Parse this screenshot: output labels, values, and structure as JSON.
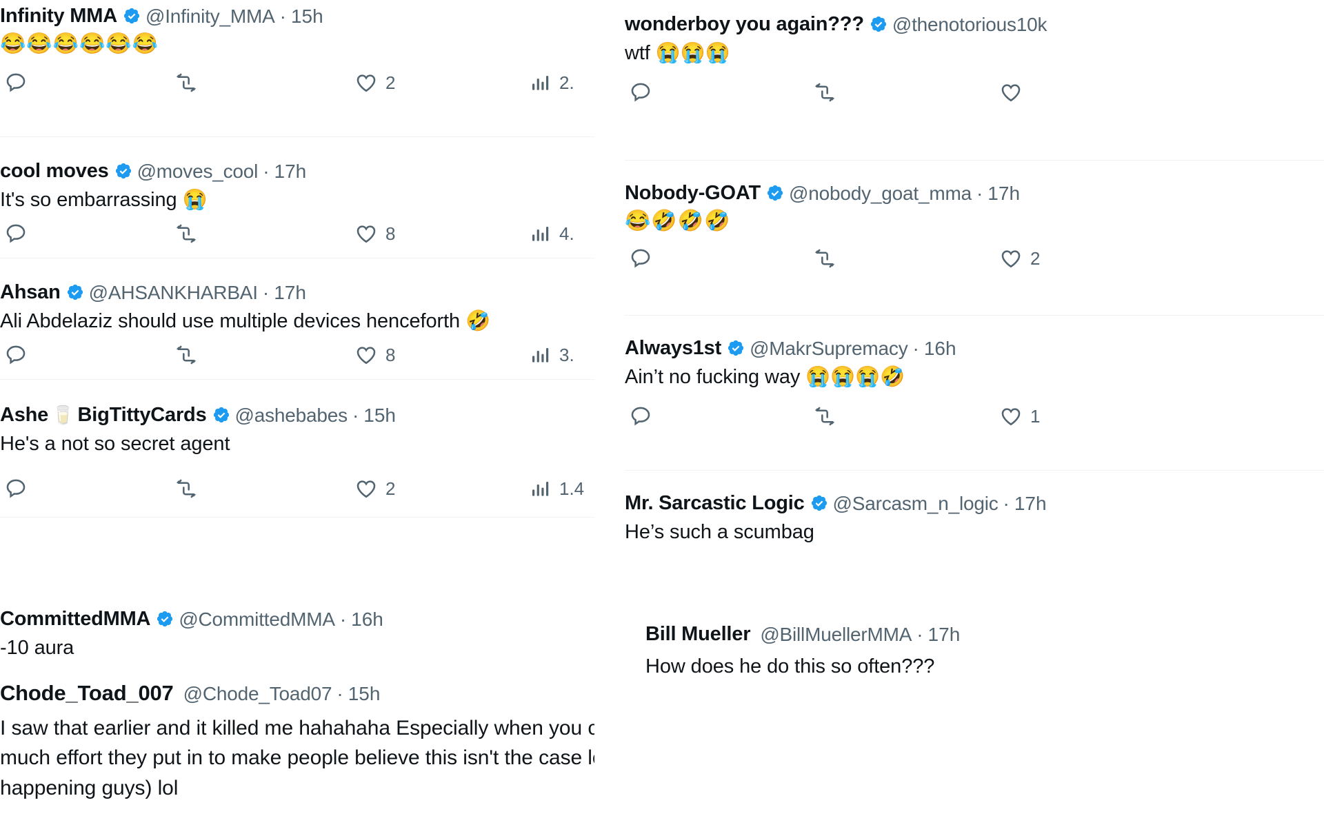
{
  "meta": {
    "platform": "twitter-replies-screenshot",
    "background_color": "#ffffff",
    "text_color": "#0f1419",
    "muted_text_color": "#536471",
    "verified_badge_color": "#1D9BF0",
    "divider_color": "#eff3f4"
  },
  "icons": {
    "reply": "reply-icon",
    "retweet": "retweet-icon",
    "like": "heart-icon",
    "views": "views-bar-chart-icon",
    "verified": "verified-badge-icon"
  },
  "left_column": {
    "tweets": [
      {
        "display_name": "Infinity MMA",
        "verified": true,
        "handle": "@Infinity_MMA",
        "separator": "·",
        "timestamp": "15h",
        "body": "😂😂😂😂😂😂",
        "body_is_emoji": true,
        "actions": {
          "reply_count": "",
          "retweet_count": "",
          "like_count": "2",
          "views_count": "2."
        }
      },
      {
        "display_name": "cool moves",
        "verified": true,
        "handle": "@moves_cool",
        "separator": "·",
        "timestamp": "17h",
        "body": "It's so embarrassing 😭",
        "body_is_emoji": false,
        "actions": {
          "reply_count": "",
          "retweet_count": "",
          "like_count": "8",
          "views_count": "4."
        }
      },
      {
        "display_name": "Ahsan",
        "verified": true,
        "handle": "@AHSANKHARBAI",
        "separator": "·",
        "timestamp": "17h",
        "body": "Ali Abdelaziz should use multiple devices henceforth 🤣",
        "body_is_emoji": false,
        "actions": {
          "reply_count": "",
          "retweet_count": "",
          "like_count": "8",
          "views_count": "3."
        }
      },
      {
        "display_name": "Ashe",
        "name_emoji": "🥛",
        "display_name_2": "BigTittyCards",
        "verified": true,
        "handle": "@ashebabes",
        "separator": "·",
        "timestamp": "15h",
        "body": "He's a not so secret agent",
        "body_is_emoji": false,
        "actions": {
          "reply_count": "",
          "retweet_count": "",
          "like_count": "2",
          "views_count": "1.4"
        }
      },
      {
        "display_name": "CommittedMMA",
        "verified": true,
        "handle": "@CommittedMMA",
        "separator": "·",
        "timestamp": "16h",
        "body": "-10 aura",
        "body_is_emoji": false,
        "actions": null
      },
      {
        "display_name": "Chode_Toad_007",
        "verified": false,
        "handle": "@Chode_Toad07",
        "separator": "·",
        "timestamp": "15h",
        "body": "I saw that earlier and it killed me hahahaha Especially when you consider how much effort they put in to make people believe this isn't the case lol (it's not happening guys) lol",
        "body_is_emoji": false,
        "actions": null
      }
    ]
  },
  "right_column": {
    "tweets": [
      {
        "display_name": "wonderboy you again???",
        "verified": true,
        "handle": "@thenotorious10k",
        "separator": "",
        "timestamp": "",
        "body": "wtf 😭😭😭",
        "body_is_emoji": false,
        "actions": {
          "reply_count": "",
          "retweet_count": "",
          "like_count": ""
        }
      },
      {
        "display_name": "Nobody-GOAT",
        "verified": true,
        "handle": "@nobody_goat_mma",
        "separator": "·",
        "timestamp": "17h",
        "body": "😂🤣🤣🤣",
        "body_is_emoji": true,
        "actions": {
          "reply_count": "",
          "retweet_count": "",
          "like_count": "2"
        }
      },
      {
        "display_name": "Always1st",
        "verified": true,
        "handle": "@MakrSupremacy",
        "separator": "·",
        "timestamp": "16h",
        "body": "Ain’t no fucking way 😭😭😭🤣",
        "body_is_emoji": false,
        "actions": {
          "reply_count": "",
          "retweet_count": "",
          "like_count": "1"
        }
      },
      {
        "display_name": "Mr. Sarcastic Logic",
        "verified": true,
        "handle": "@Sarcasm_n_logic",
        "separator": "·",
        "timestamp": "17h",
        "body": "He’s such a scumbag",
        "body_is_emoji": false,
        "actions": null
      },
      {
        "display_name": "Bill Mueller",
        "verified": false,
        "handle": "@BillMuellerMMA",
        "separator": "·",
        "timestamp": "17h",
        "body": "How does he do this so often???",
        "body_is_emoji": false,
        "actions": null
      }
    ]
  }
}
